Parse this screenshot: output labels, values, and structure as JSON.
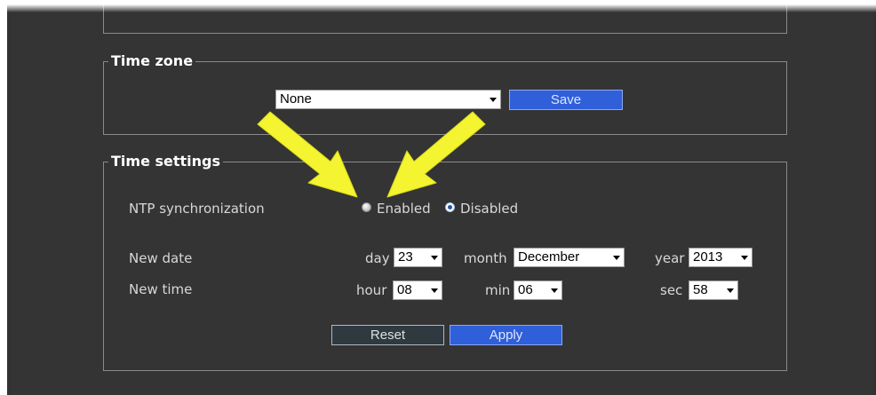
{
  "time_zone": {
    "legend": "Time zone",
    "select_value": "None",
    "save_label": "Save"
  },
  "time_settings": {
    "legend": "Time settings",
    "ntp_label": "NTP synchronization",
    "ntp_options": [
      "Enabled",
      "Disabled"
    ],
    "ntp_selected": "Disabled",
    "new_date_label": "New date",
    "new_time_label": "New time",
    "day_label": "day",
    "day_value": "23",
    "month_label": "month",
    "month_value": "December",
    "year_label": "year",
    "year_value": "2013",
    "hour_label": "hour",
    "hour_value": "08",
    "min_label": "min",
    "min_value": "06",
    "sec_label": "sec",
    "sec_value": "58",
    "reset_label": "Reset",
    "apply_label": "Apply"
  },
  "colors": {
    "panel_bg": "#343434",
    "accent_blue": "#2f5fd9",
    "annotation_arrow": "#f4f430"
  }
}
